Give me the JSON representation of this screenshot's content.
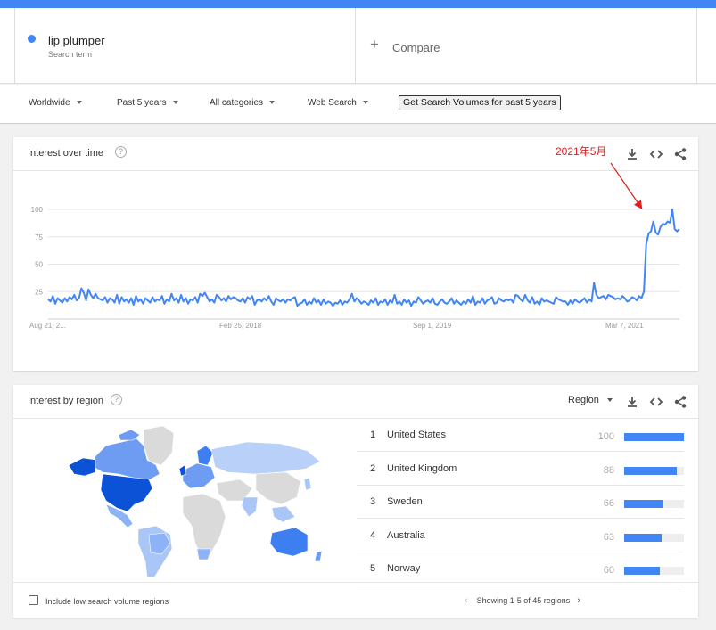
{
  "search_term": {
    "name": "lip plumper",
    "subtitle": "Search term",
    "color": "#4285f4"
  },
  "compare": {
    "label": "Compare",
    "plus": "+"
  },
  "filters": {
    "geo": "Worldwide",
    "time": "Past 5 years",
    "category": "All categories",
    "property": "Web Search",
    "volume_button": "Get Search Volumes for past 5 years"
  },
  "interest_over_time": {
    "title": "Interest over time",
    "annotation": "2021年5月",
    "help": "?",
    "download_icon": "download-icon",
    "embed_icon": "embed-icon",
    "share_icon": "share-icon"
  },
  "chart_data": {
    "type": "line",
    "ylim": [
      0,
      100
    ],
    "y_ticks": [
      25,
      50,
      75,
      100
    ],
    "grid": true,
    "x_tick_labels": [
      "Aug 21, 2...",
      "Feb 25, 2018",
      "Sep 1, 2019",
      "Mar 7, 2021"
    ],
    "series": [
      {
        "color": "#4285f4",
        "values": [
          18,
          16,
          21,
          14,
          19,
          17,
          15,
          19,
          16,
          20,
          18,
          22,
          17,
          19,
          28,
          24,
          17,
          27,
          22,
          19,
          23,
          19,
          18,
          17,
          20,
          15,
          19,
          18,
          15,
          22,
          14,
          20,
          16,
          18,
          15,
          19,
          13,
          21,
          16,
          18,
          14,
          19,
          17,
          15,
          20,
          16,
          18,
          17,
          21,
          14,
          18,
          16,
          23,
          17,
          19,
          15,
          22,
          16,
          19,
          14,
          18,
          17,
          20,
          15,
          23,
          21,
          24,
          20,
          16,
          18,
          15,
          22,
          20,
          17,
          19,
          16,
          21,
          18,
          20,
          19,
          17,
          16,
          19,
          15,
          20,
          18,
          21,
          13,
          17,
          18,
          16,
          19,
          17,
          21,
          16,
          13,
          19,
          17,
          16,
          18,
          15,
          18,
          17,
          19,
          20,
          12,
          14,
          15,
          18,
          13,
          16,
          14,
          19,
          15,
          17,
          13,
          18,
          14,
          16,
          15,
          12,
          15,
          14,
          17,
          13,
          16,
          15,
          18,
          23,
          16,
          19,
          17,
          14,
          16,
          15,
          13,
          17,
          15,
          19,
          13,
          16,
          15,
          18,
          13,
          17,
          15,
          22,
          14,
          16,
          13,
          18,
          15,
          17,
          12,
          16,
          15,
          20,
          17,
          14,
          16,
          17,
          15,
          19,
          14,
          13,
          16,
          18,
          15,
          14,
          16,
          19,
          14,
          17,
          15,
          13,
          16,
          14,
          18,
          15,
          21,
          13,
          16,
          15,
          19,
          14,
          17,
          18,
          20,
          14,
          15,
          19,
          17,
          16,
          18,
          17,
          18,
          15,
          22,
          21,
          18,
          16,
          22,
          17,
          15,
          20,
          14,
          16,
          13,
          19,
          16,
          17,
          16,
          15,
          14,
          20,
          18,
          17,
          16,
          16,
          13,
          17,
          14,
          18,
          16,
          15,
          17,
          19,
          15,
          18,
          16,
          33,
          22,
          19,
          20,
          21,
          18,
          22,
          21,
          20,
          18,
          19,
          18,
          21,
          19,
          16,
          17,
          20,
          19,
          17,
          21,
          19,
          25,
          68,
          78,
          80,
          89,
          79,
          77,
          84,
          87,
          86,
          89,
          88,
          100,
          82,
          80,
          82
        ]
      }
    ]
  },
  "interest_by_region": {
    "title": "Interest by region",
    "help": "?",
    "region_select": "Region",
    "rows": [
      {
        "rank": "1",
        "country": "United States",
        "value": 100
      },
      {
        "rank": "2",
        "country": "United Kingdom",
        "value": 88
      },
      {
        "rank": "3",
        "country": "Sweden",
        "value": 66
      },
      {
        "rank": "4",
        "country": "Australia",
        "value": 63
      },
      {
        "rank": "5",
        "country": "Norway",
        "value": 60
      }
    ],
    "low_volume_label": "Include low search volume regions",
    "pager_text": "Showing 1-5 of 45 regions",
    "prev_icon": "chevron-left-icon",
    "next_icon": "chevron-right-icon"
  }
}
